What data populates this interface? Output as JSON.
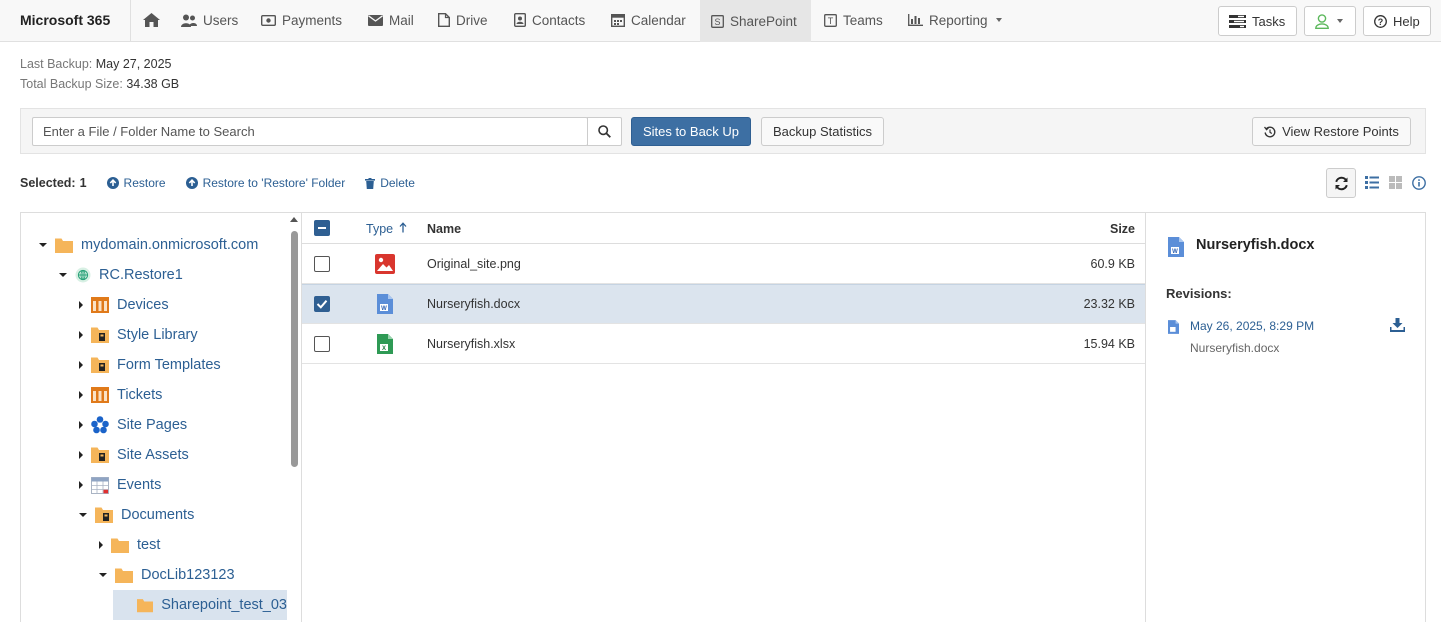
{
  "app": {
    "title": "Microsoft 365"
  },
  "nav": {
    "items": [
      {
        "label": ""
      },
      {
        "label": "Users"
      },
      {
        "label": "Payments"
      },
      {
        "label": "Mail"
      },
      {
        "label": "Drive"
      },
      {
        "label": "Contacts"
      },
      {
        "label": "Calendar"
      },
      {
        "label": "SharePoint"
      },
      {
        "label": "Teams"
      },
      {
        "label": "Reporting"
      }
    ],
    "active": "SharePoint",
    "tasks_label": "Tasks",
    "help_label": "Help"
  },
  "backup_info": {
    "last_backup_label": "Last Backup:",
    "last_backup_value": "May 27, 2025",
    "total_size_label": "Total Backup Size:",
    "total_size_value": "34.38 GB"
  },
  "toolbar": {
    "search_placeholder": "Enter a File / Folder Name to Search",
    "sites_to_back_up": "Sites to Back Up",
    "backup_statistics": "Backup Statistics",
    "view_restore_points": "View Restore Points"
  },
  "selection": {
    "label": "Selected:",
    "count": "1",
    "restore": "Restore",
    "restore_to_folder": "Restore to 'Restore' Folder",
    "delete": "Delete"
  },
  "tree": {
    "items": [
      {
        "label": "mydomain.onmicrosoft.com",
        "icon": "folder-icon"
      },
      {
        "label": "RC.Restore1",
        "icon": "globe-icon"
      },
      {
        "label": "Devices",
        "icon": "list-icon"
      },
      {
        "label": "Style Library",
        "icon": "library-icon"
      },
      {
        "label": "Form Templates",
        "icon": "library-icon"
      },
      {
        "label": "Tickets",
        "icon": "list-icon"
      },
      {
        "label": "Site Pages",
        "icon": "site-pages-icon"
      },
      {
        "label": "Site Assets",
        "icon": "library-icon"
      },
      {
        "label": "Events",
        "icon": "calendar-list-icon"
      },
      {
        "label": "Documents",
        "icon": "library-icon"
      },
      {
        "label": "test",
        "icon": "folder-icon"
      },
      {
        "label": "DocLib123123",
        "icon": "folder-icon"
      },
      {
        "label": "Sharepoint_test_03",
        "icon": "folder-icon"
      }
    ]
  },
  "files": {
    "headers": {
      "type": "Type",
      "name": "Name",
      "size": "Size"
    },
    "rows": [
      {
        "name": "Original_site.png",
        "size": "60.9 KB",
        "type": "image",
        "checked": false
      },
      {
        "name": "Nurseryfish.docx",
        "size": "23.32 KB",
        "type": "word",
        "checked": true
      },
      {
        "name": "Nurseryfish.xlsx",
        "size": "15.94 KB",
        "type": "excel",
        "checked": false
      }
    ]
  },
  "details": {
    "file_name": "Nurseryfish.docx",
    "revisions_label": "Revisions:",
    "revisions": [
      {
        "date": "May 26, 2025, 8:29 PM",
        "file": "Nurseryfish.docx"
      }
    ]
  },
  "colors": {
    "accent": "#3d6fa3",
    "link": "#2c5f93",
    "folder": "#f5b55a",
    "selected_row": "#dbe4ee"
  }
}
